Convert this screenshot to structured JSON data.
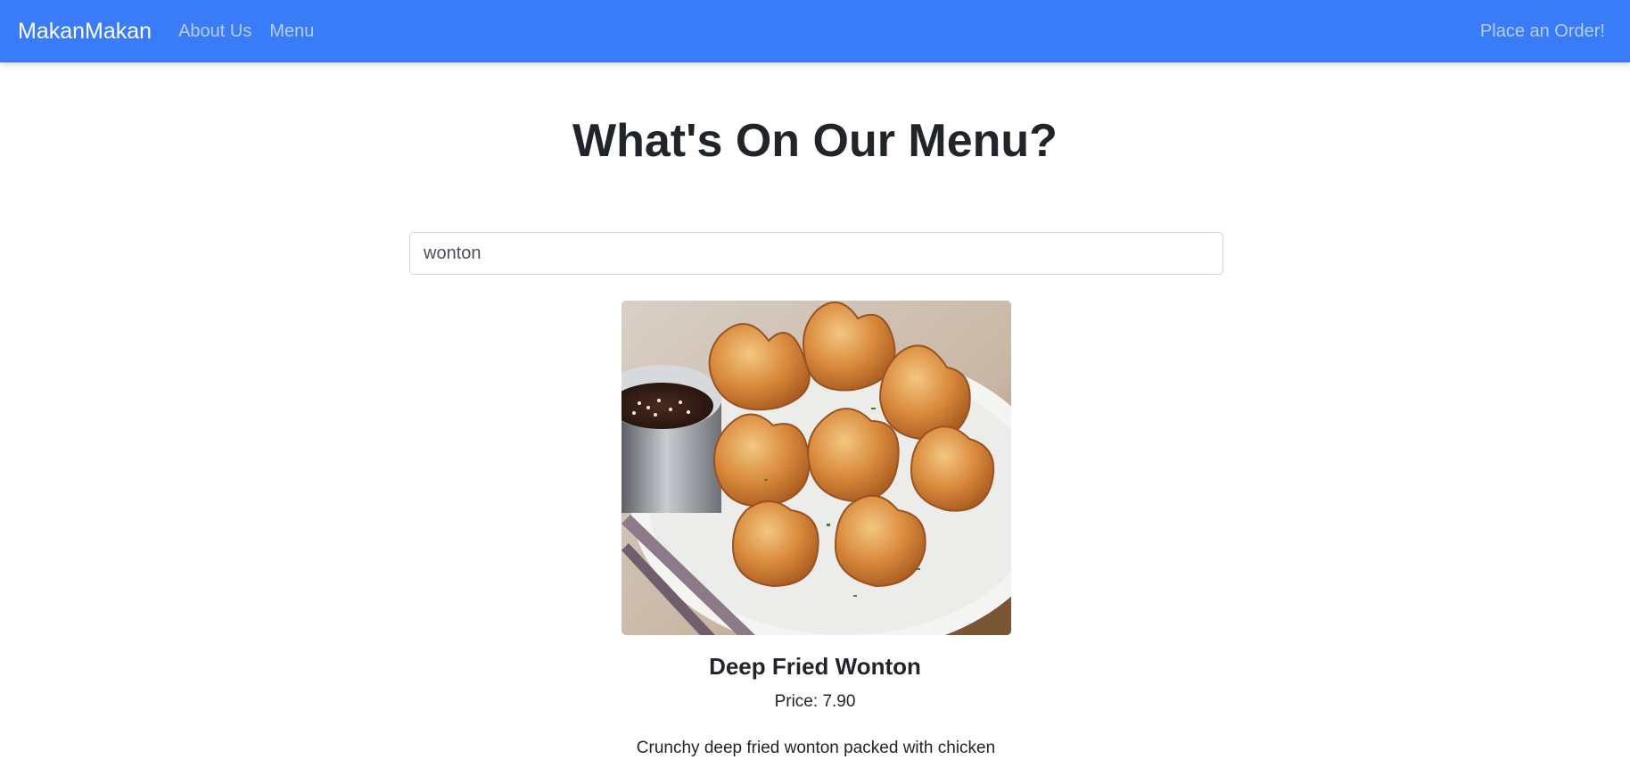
{
  "navbar": {
    "brand": "MakanMakan",
    "links": [
      "About Us",
      "Menu"
    ],
    "cta": "Place an Order!",
    "background_color": "#3a7bf7"
  },
  "main": {
    "title": "What's On Our Menu?",
    "search": {
      "value": "wonton",
      "placeholder": ""
    },
    "item": {
      "image_icon": "deep-fried-wonton-photo",
      "name": "Deep Fried Wonton",
      "price_label": "Price:",
      "price": "7.90",
      "description": "Crunchy deep fried wonton packed with chicken"
    }
  }
}
